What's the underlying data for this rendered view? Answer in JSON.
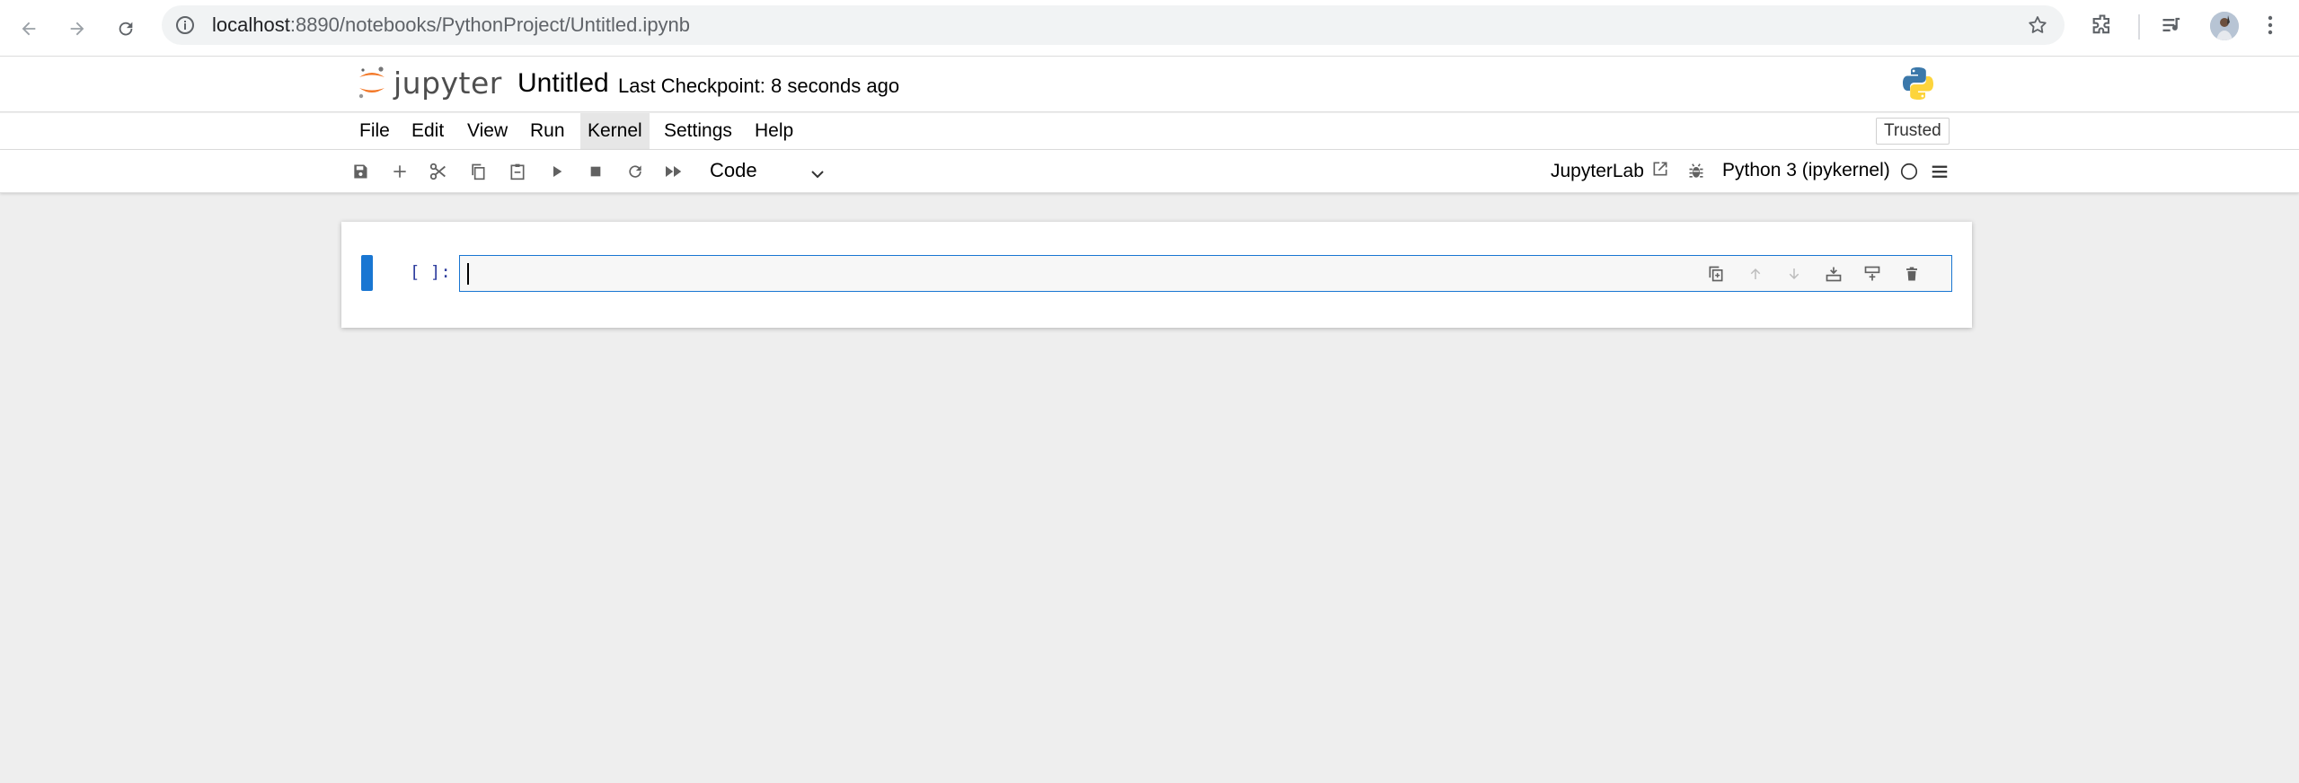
{
  "browser": {
    "url_host": "localhost",
    "url_path": ":8890/notebooks/PythonProject/Untitled.ipynb",
    "icons": [
      "back-icon",
      "forward-icon",
      "reload-icon",
      "site-info-icon",
      "bookmark-star-icon",
      "extensions-icon",
      "media-control-icon",
      "profile-avatar",
      "more-menu-icon"
    ]
  },
  "header": {
    "logo_text": "jupyter",
    "notebook_title": "Untitled",
    "checkpoint": "Last Checkpoint: 8 seconds ago",
    "kernel_logo": "python-logo"
  },
  "menu": {
    "items": [
      "File",
      "Edit",
      "View",
      "Run",
      "Kernel",
      "Settings",
      "Help"
    ],
    "active": "Kernel",
    "trusted_label": "Trusted"
  },
  "toolbar": {
    "cell_type": "Code",
    "jupyterlab_label": "JupyterLab",
    "kernel_name": "Python 3 (ipykernel)",
    "icons": [
      "save-icon",
      "add-cell-icon",
      "cut-icon",
      "copy-icon",
      "paste-icon",
      "run-icon",
      "stop-icon",
      "restart-icon",
      "run-all-icon",
      "external-link-icon",
      "debugger-icon",
      "kernel-status-icon",
      "command-palette-icon"
    ]
  },
  "cell": {
    "prompt": "[ ]:",
    "source": "",
    "tools": [
      "duplicate-cell-icon",
      "move-up-icon",
      "move-down-icon",
      "insert-below-icon",
      "insert-above-icon",
      "delete-cell-icon"
    ]
  },
  "colors": {
    "accent": "#1976d2",
    "jupyter_orange": "#f37726",
    "background": "#eeeeee"
  }
}
